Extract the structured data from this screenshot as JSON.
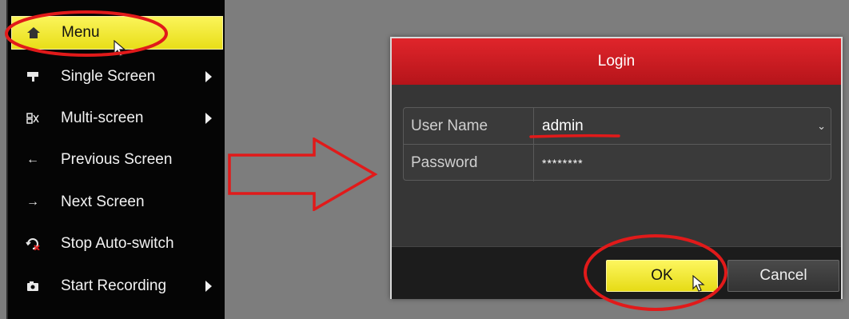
{
  "menu": {
    "items": [
      {
        "label": "Menu",
        "icon": "home-icon",
        "active": true,
        "submenu": false
      },
      {
        "label": "Single Screen",
        "icon": "monitor-stand-icon",
        "active": false,
        "submenu": true
      },
      {
        "label": "Multi-screen",
        "icon": "multi-screen-icon",
        "active": false,
        "submenu": true
      },
      {
        "label": "Previous Screen",
        "icon": "arrow-left-icon",
        "active": false,
        "submenu": false
      },
      {
        "label": "Next Screen",
        "icon": "arrow-right-icon",
        "active": false,
        "submenu": false
      },
      {
        "label": "Stop Auto-switch",
        "icon": "stop-switch-icon",
        "active": false,
        "submenu": false
      },
      {
        "label": "Start Recording",
        "icon": "camera-record-icon",
        "active": false,
        "submenu": true
      }
    ]
  },
  "login": {
    "title": "Login",
    "username_label": "User Name",
    "username_value": "admin",
    "password_label": "Password",
    "password_value": "********",
    "ok_label": "OK",
    "cancel_label": "Cancel"
  },
  "colors": {
    "accent_yellow": "#f3ea2c",
    "title_red": "#cc1c22",
    "annotation_red": "#e11a1a"
  }
}
